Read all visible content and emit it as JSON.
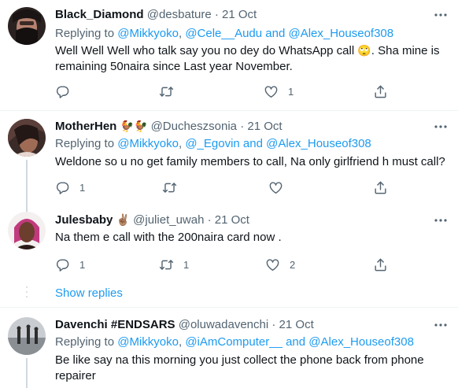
{
  "tweets": [
    {
      "name": "Black_Diamond",
      "handle": "@desbature",
      "sep": "·",
      "date": "21 Oct",
      "replying_prefix": "Replying to",
      "mention_1": "@Mikkyoko",
      "comma": ",",
      "mention_2": "@Cele__Audu",
      "and_mention": "and @Alex_Houseof308",
      "text_1": "Well Well Well who talk say you no dey do WhatsApp call",
      "emoji_1": "🙄",
      "text_2": ". Sha mine is remaining 50naira since Last year November.",
      "reply_count": "",
      "retweet_count": "",
      "like_count": "1"
    },
    {
      "name": "MotherHen",
      "name_emoji": "🐓🐓",
      "handle": "@Ducheszsonia",
      "sep": "·",
      "date": "21 Oct",
      "replying_prefix": "Replying to",
      "mention_1": "@Mikkyoko",
      "comma": ",",
      "mention_2": "@_Egovin",
      "and_mention": "and @Alex_Houseof308",
      "text_1": "Weldone so u no get family members to call, Na only girlfriend h must call?",
      "reply_count": "1",
      "retweet_count": "",
      "like_count": ""
    },
    {
      "name": "Julesbaby",
      "name_emoji": "✌🏽",
      "handle": "@juliet_uwah",
      "sep": "·",
      "date": "21 Oct",
      "text_1": "Na them e call with the 200naira card now .",
      "reply_count": "1",
      "retweet_count": "1",
      "like_count": "2"
    },
    {
      "name": "Davenchi #ENDSARS",
      "handle": "@oluwadavenchi",
      "sep": "·",
      "date": "21 Oct",
      "replying_prefix": "Replying to",
      "mention_1": "@Mikkyoko",
      "comma": ",",
      "mention_2": "@iAmComputer__",
      "and_mention": "and @Alex_Houseof308",
      "text_1": "Be like say na this morning you just collect the phone back from phone repairer"
    }
  ],
  "show_replies": "Show replies",
  "colors": {
    "accent": "#1d9bf0",
    "muted": "#536471",
    "text": "#0f1419",
    "divider": "#eff3f4"
  },
  "icons": [
    "more-icon",
    "reply-icon",
    "retweet-icon",
    "like-icon",
    "share-icon"
  ]
}
